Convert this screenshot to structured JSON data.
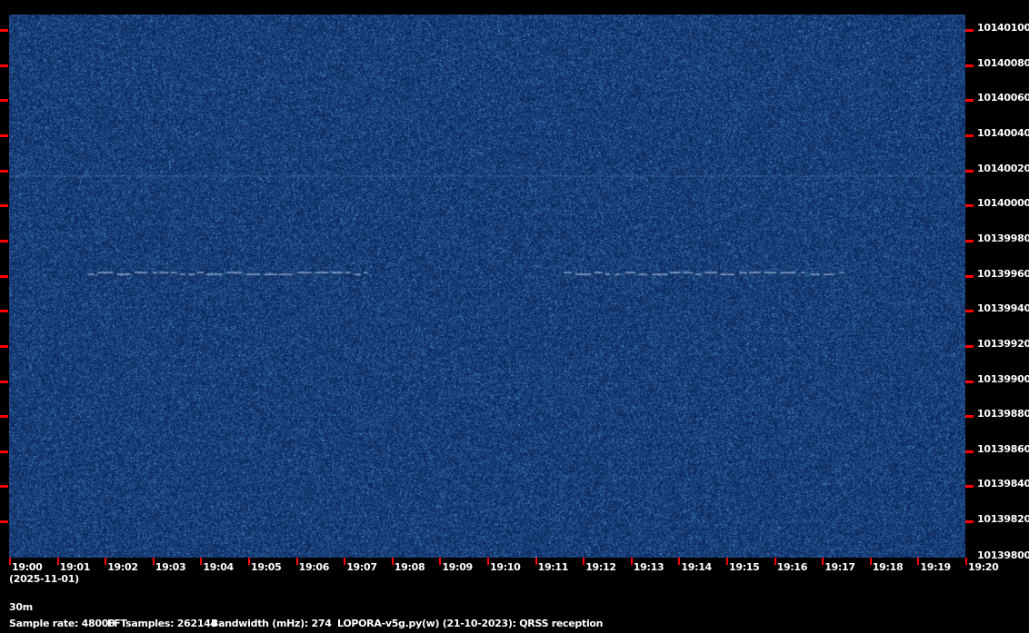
{
  "chart_data": {
    "type": "heatmap",
    "title": "LOPORA-v5g.py(w) (21-10-2023): QRSS reception",
    "x_ticks": [
      "19:00",
      "19:01",
      "19:02",
      "19:03",
      "19:04",
      "19:05",
      "19:06",
      "19:07",
      "19:08",
      "19:09",
      "19:10",
      "19:11",
      "19:12",
      "19:13",
      "19:14",
      "19:15",
      "19:16",
      "19:17",
      "19:18",
      "19:19",
      "19:20"
    ],
    "date": "(2025-11-01)",
    "y_ticks": [
      "10140100",
      "10140080",
      "10140060",
      "10140040",
      "10140020",
      "10140000",
      "10139980",
      "10139960",
      "10139940",
      "10139920",
      "10139900",
      "10139880",
      "10139860",
      "10139840",
      "10139820",
      "10139800"
    ],
    "xlim_minutes": [
      0,
      20
    ],
    "ylim_hz": [
      10139800,
      10140110
    ],
    "signals": [
      {
        "start_min": 1.65,
        "end_min": 7.5,
        "freq_hz": 10139961
      },
      {
        "start_min": 11.6,
        "end_min": 17.45,
        "freq_hz": 10139961
      }
    ],
    "carrier_line_hz": 10140017,
    "colors": {
      "background": "#0f2c63",
      "tick": "#ff0000",
      "signal": "#c8d4e8"
    }
  },
  "footer": {
    "band": "30m",
    "sample_rate": "Sample rate: 48000",
    "fft_samples": "FFTsamples: 262144",
    "bandwidth": "Bandwidth (mHz): 274",
    "software": "LOPORA-v5g.py(w) (21-10-2023): QRSS reception"
  }
}
